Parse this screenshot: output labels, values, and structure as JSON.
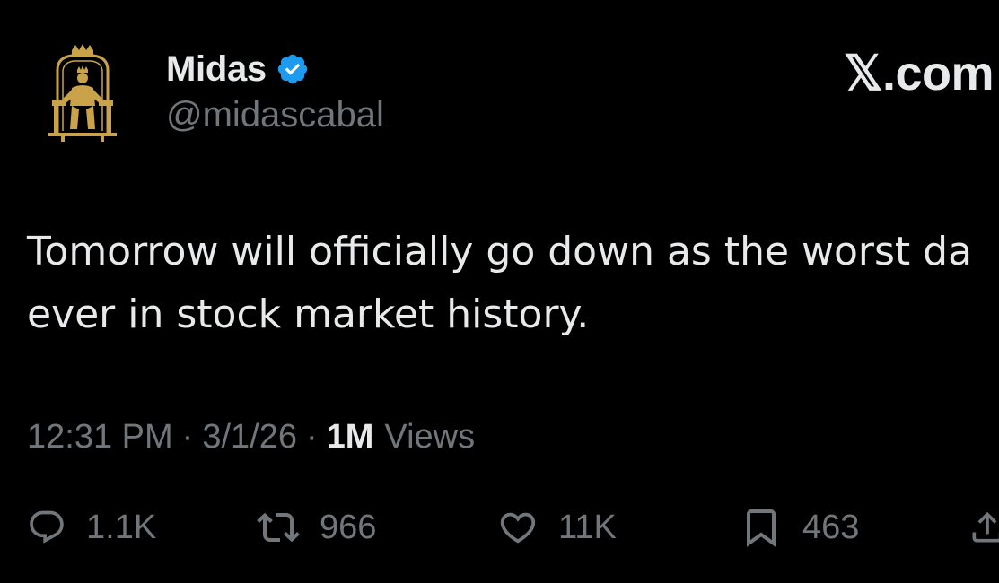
{
  "author": {
    "display_name": "Midas",
    "handle": "@midascabal",
    "avatar_icon": "king-on-throne-icon",
    "verified_icon": "verified-badge-icon",
    "verified_color": "#1d9bf0",
    "avatar_color": "#c9a24a"
  },
  "site_logo": "𝕏.com",
  "tweet": {
    "text_lines": [
      "Tomorrow will officially go down as the worst da",
      "ever in stock market history."
    ]
  },
  "meta": {
    "time": "12:31 PM",
    "separator": "·",
    "date": "3/1/26",
    "views_count": "1M",
    "views_label": "Views"
  },
  "actions": {
    "reply": {
      "icon": "reply-icon",
      "count": "1.1K"
    },
    "retweet": {
      "icon": "retweet-icon",
      "count": "966"
    },
    "like": {
      "icon": "heart-icon",
      "count": "11K"
    },
    "bookmark": {
      "icon": "bookmark-icon",
      "count": "463"
    },
    "share": {
      "icon": "share-icon"
    }
  },
  "colors": {
    "background": "#000000",
    "primary_text": "#e7e9ea",
    "secondary_text": "#71767b"
  }
}
